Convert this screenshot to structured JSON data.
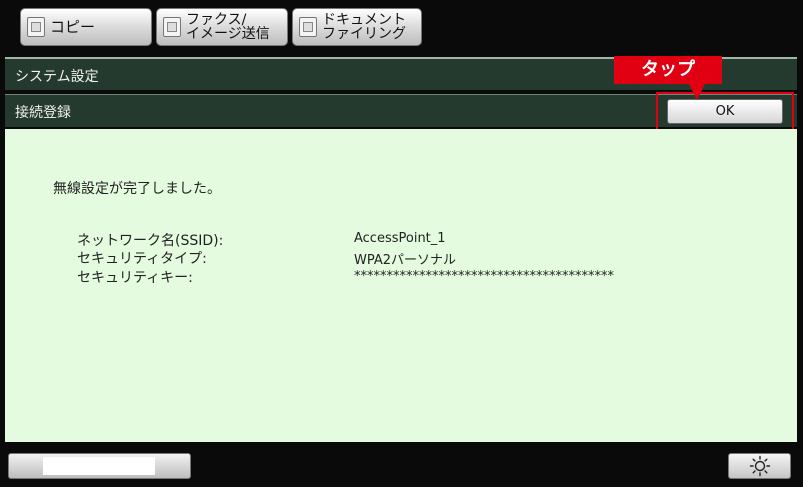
{
  "tabs": [
    {
      "label_lines": [
        "コピー"
      ]
    },
    {
      "label_lines": [
        "ファクス/",
        "イメージ送信"
      ]
    },
    {
      "label_lines": [
        "ドキュメント",
        "ファイリング"
      ]
    }
  ],
  "header": {
    "system_title": "システム設定",
    "sub_title": "接続登録",
    "ok_label": "OK",
    "callout_label": "タップ"
  },
  "content": {
    "message": "無線設定が完了しました。",
    "fields": [
      {
        "label": "ネットワーク名(SSID):",
        "value": "AccessPoint_1"
      },
      {
        "label": "セキュリティタイプ:",
        "value": "WPA2パーソナル"
      },
      {
        "label": "セキュリティキー:",
        "value": "****************************************"
      }
    ]
  },
  "icons": {
    "tab_icon": "document-icon",
    "bottom_right": "brightness-icon"
  },
  "colors": {
    "callout": "#e00012",
    "header_bar": "#253a2f",
    "panel": "#e4fbdf"
  }
}
